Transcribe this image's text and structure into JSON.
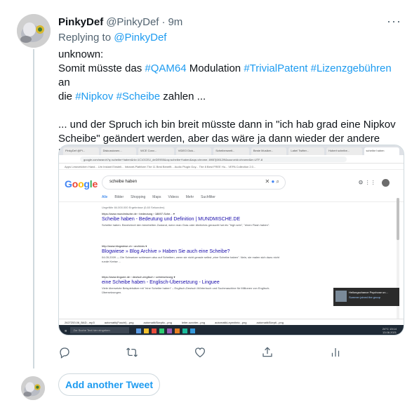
{
  "tweet": {
    "name": "PinkyDef",
    "handle": "@PinkyDef",
    "dot": "·",
    "time": "9m",
    "more": "···",
    "reply_prefix": "Replying to",
    "reply_handle": "@PinkyDef",
    "body": [
      [
        {
          "t": "unknown:",
          "k": "text"
        }
      ],
      [
        {
          "t": "Somit müsste das ",
          "k": "text"
        },
        {
          "t": "#QAM64",
          "k": "tag"
        },
        {
          "t": " Modulation ",
          "k": "text"
        },
        {
          "t": "#TrivialPatent",
          "k": "tag"
        },
        {
          "t": " ",
          "k": "text"
        },
        {
          "t": "#Lizenzgebühren",
          "k": "tag"
        },
        {
          "t": " an",
          "k": "text"
        }
      ],
      [
        {
          "t": "die ",
          "k": "text"
        },
        {
          "t": "#Nipkov",
          "k": "tag"
        },
        {
          "t": " ",
          "k": "text"
        },
        {
          "t": "#Scheibe",
          "k": "tag"
        },
        {
          "t": " zahlen ...",
          "k": "text"
        }
      ],
      [],
      [
        {
          "t": "... und der Spruch ich bin breit müsste dann in \"ich hab grad eine Nipkov",
          "k": "text"
        }
      ],
      [
        {
          "t": "Scheibe\" geändert werden, aber das wäre ja dann wieder der andere",
          "k": "text"
        }
      ],
      [
        {
          "t": "Potcast.",
          "k": "text"
        }
      ]
    ]
  },
  "screenshot": {
    "tabs": [
      "PinkyDef @Pi...",
      "Diskussionen...",
      "WCE Conv...",
      "VIDEO Dick...",
      "Scheibenwelt...",
      "Beste Musiker...",
      "Label Twitter...",
      "Hubert scheibe...",
      "scheibe haben"
    ],
    "address": "google.com/search?q=scheibe+haben&rlz=1C1GCEU_deDE955&oq=scheibe+haben&aqs=chrome..69i57j0i512l9&sourceid=chrome&ie=UTF-8",
    "bookmarks": "Apps   Lesezeichen Hand...   Um Instant Einsteli...   Intranet-Plattform   The 11 Best Benefit...   Audio Plugin Guy...   The 8 Best FREE Hu...   VEPA Collection 2.0...",
    "search_query": "scheibe haben",
    "search_tabs": [
      "Alle",
      "Bilder",
      "Shopping",
      "Maps",
      "Videos",
      "Mehr",
      "Suchfilter"
    ],
    "result_count": "Ungefähr 84.000.000 Ergebnisse (0,60 Sekunden)",
    "results": [
      {
        "url": "https://www.mundmische.de › bedeutung › 18697-Sche... ▾",
        "title": "Scheibe haben - Bedeutung und Definition | MUNDMISCHE.DE",
        "snippet": "Scheibe haben. Bezeichnet den benebelten Zustand, wenn man Gras oder ähnliches geraucht hat etc \"high sein\", \"einen Flash haben\"."
      },
      {
        "url": "http://www.blogwiese.ch › archives ▾",
        "title": "Blogwiese » Blog Archive » Haben Sie auch eine Scheibe?",
        "snippet": "04.05.2009 — Die Schweizer schiessen also auf Scheiben, wenn sie nicht gerade selbst „eine Scheibe haben\". Nein, sie malen sich dazu nicht runde Kreise ..."
      },
      {
        "url": "https://www.linguee.de › deutsch-englisch › uebersetzung ▾",
        "title": "eine Scheibe haben - Englisch-Übersetzung - Linguee",
        "snippet": "Viele übersetzte Beispielsätze mit \"eine Scheibe haben\" – Englisch-Deutsch Wörterbuch und Suchmaschine für Millionen von Englisch-Übersetzungen."
      }
    ],
    "notification_title": "Hellongschance Psychose un...",
    "notification_sub": "Summer joined the group",
    "downloads": [
      "2627253.06_BAD...mp3",
      "automatik(Fuschl)...png",
      "automatikSkeptic...png",
      "leiter-scrotter...png",
      "automatikLeyeniteiz...png",
      "automatikSkepti...png"
    ],
    "taskbar_search": "Zur Suche Text hier eingeben",
    "clock_time": "13:14",
    "clock_date": "13.08.2021",
    "temp": "24°C"
  },
  "actions": {
    "reply_icon": "reply-icon",
    "retweet_icon": "retweet-icon",
    "like_icon": "heart-icon",
    "share_icon": "share-icon",
    "analytics_icon": "analytics-icon"
  },
  "add_tweet": "Add another Tweet"
}
